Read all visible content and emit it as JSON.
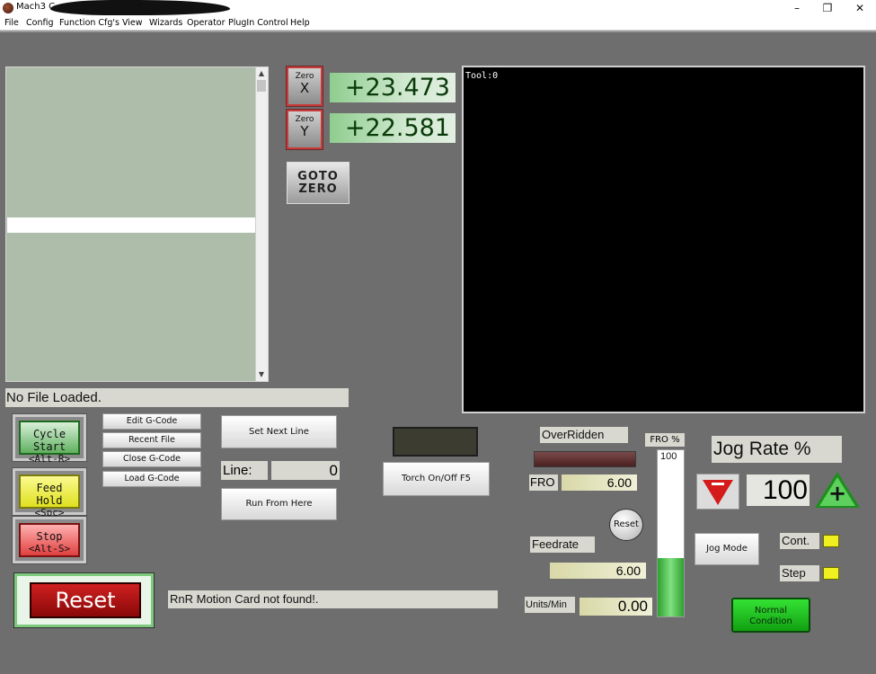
{
  "window": {
    "title": "Mach3 C",
    "controls": [
      "–",
      "❐",
      "✕"
    ]
  },
  "menu": [
    "File",
    "Config",
    "Function Cfg's",
    "View",
    "Wizards",
    "Operator",
    "PlugIn Control",
    "Help"
  ],
  "gcode": {
    "file_status": "No File Loaded."
  },
  "dro": {
    "x": {
      "zero_label": "Zero",
      "axis": "X",
      "value": "+23.473"
    },
    "y": {
      "zero_label": "Zero",
      "axis": "Y",
      "value": "+22.581"
    },
    "goto_zero": [
      "GOTO",
      "ZERO"
    ]
  },
  "toolpath": {
    "label": "Tool:0"
  },
  "cycle": {
    "start": {
      "line1": "Cycle Start",
      "line2": "<Alt-R>"
    },
    "feed_hold": {
      "line1": "Feed Hold",
      "line2": "<Spc>"
    },
    "stop": {
      "line1": "Stop",
      "line2": "<Alt-S>"
    }
  },
  "gcode_buttons": [
    "Edit G-Code",
    "Recent File",
    "Close G-Code",
    "Load G-Code"
  ],
  "line_control": {
    "set_next_line": "Set Next Line",
    "line_label": "Line:",
    "line_value": "0",
    "run_from_here": "Run From Here"
  },
  "torch": {
    "label": "Torch On/Off F5"
  },
  "reset": {
    "label": "Reset"
  },
  "motion_status": "RnR Motion Card not found!.",
  "override": {
    "overridden": "OverRidden",
    "fro_label": "FRO",
    "fro_value": "6.00",
    "fro_pct_label": "FRO %",
    "fro_slider_max": "100",
    "fro_slider_level": 0.35,
    "reset": "Reset",
    "feedrate_label": "Feedrate",
    "feedrate_value": "6.00",
    "units_label": "Units/Min",
    "units_value": "0.00"
  },
  "jog": {
    "rate_label": "Jog Rate %",
    "rate_value": "100",
    "mode": "Jog Mode",
    "cont": "Cont.",
    "step": "Step",
    "up_symbol": "+",
    "normal": [
      "Normal",
      "Condition"
    ]
  },
  "colors": {
    "panel_bg": "#6e6e6e",
    "dro_green": "#8fcd8f",
    "toolpath_bg": "#000000",
    "reset_red": "#cf2020",
    "normal_green": "#22cc22",
    "led_yellow": "#f0f020"
  }
}
